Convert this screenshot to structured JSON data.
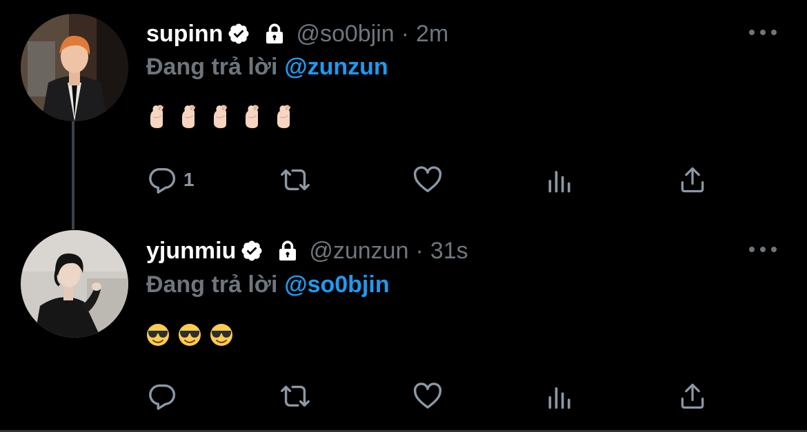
{
  "tweets": [
    {
      "display_name": "supinn",
      "handle": "@so0bjin",
      "separator": "·",
      "time": "2m",
      "replying_prefix": "Đang trả lời",
      "replying_to": "@zunzun",
      "emoji_kind": "finger-heart",
      "emoji_count": 5,
      "reply_count": "1",
      "avatar_icon": "avatar-photo"
    },
    {
      "display_name": "yjunmiu",
      "handle": "@zunzun",
      "separator": "·",
      "time": "31s",
      "replying_prefix": "Đang trả lời",
      "replying_to": "@so0bjin",
      "emoji_kind": "sunglasses-face",
      "emoji_count": 3,
      "reply_count": "",
      "avatar_icon": "avatar-photo"
    }
  ],
  "colors": {
    "background": "#000000",
    "text_primary": "#ffffff",
    "text_secondary": "#6e767d",
    "link": "#1d9bf0",
    "icon": "#8b98a5",
    "thread_line": "#3b4148"
  },
  "icons": [
    "verified-badge-icon",
    "lock-icon",
    "more-icon",
    "reply-icon",
    "retweet-icon",
    "like-icon",
    "views-icon",
    "share-icon"
  ]
}
